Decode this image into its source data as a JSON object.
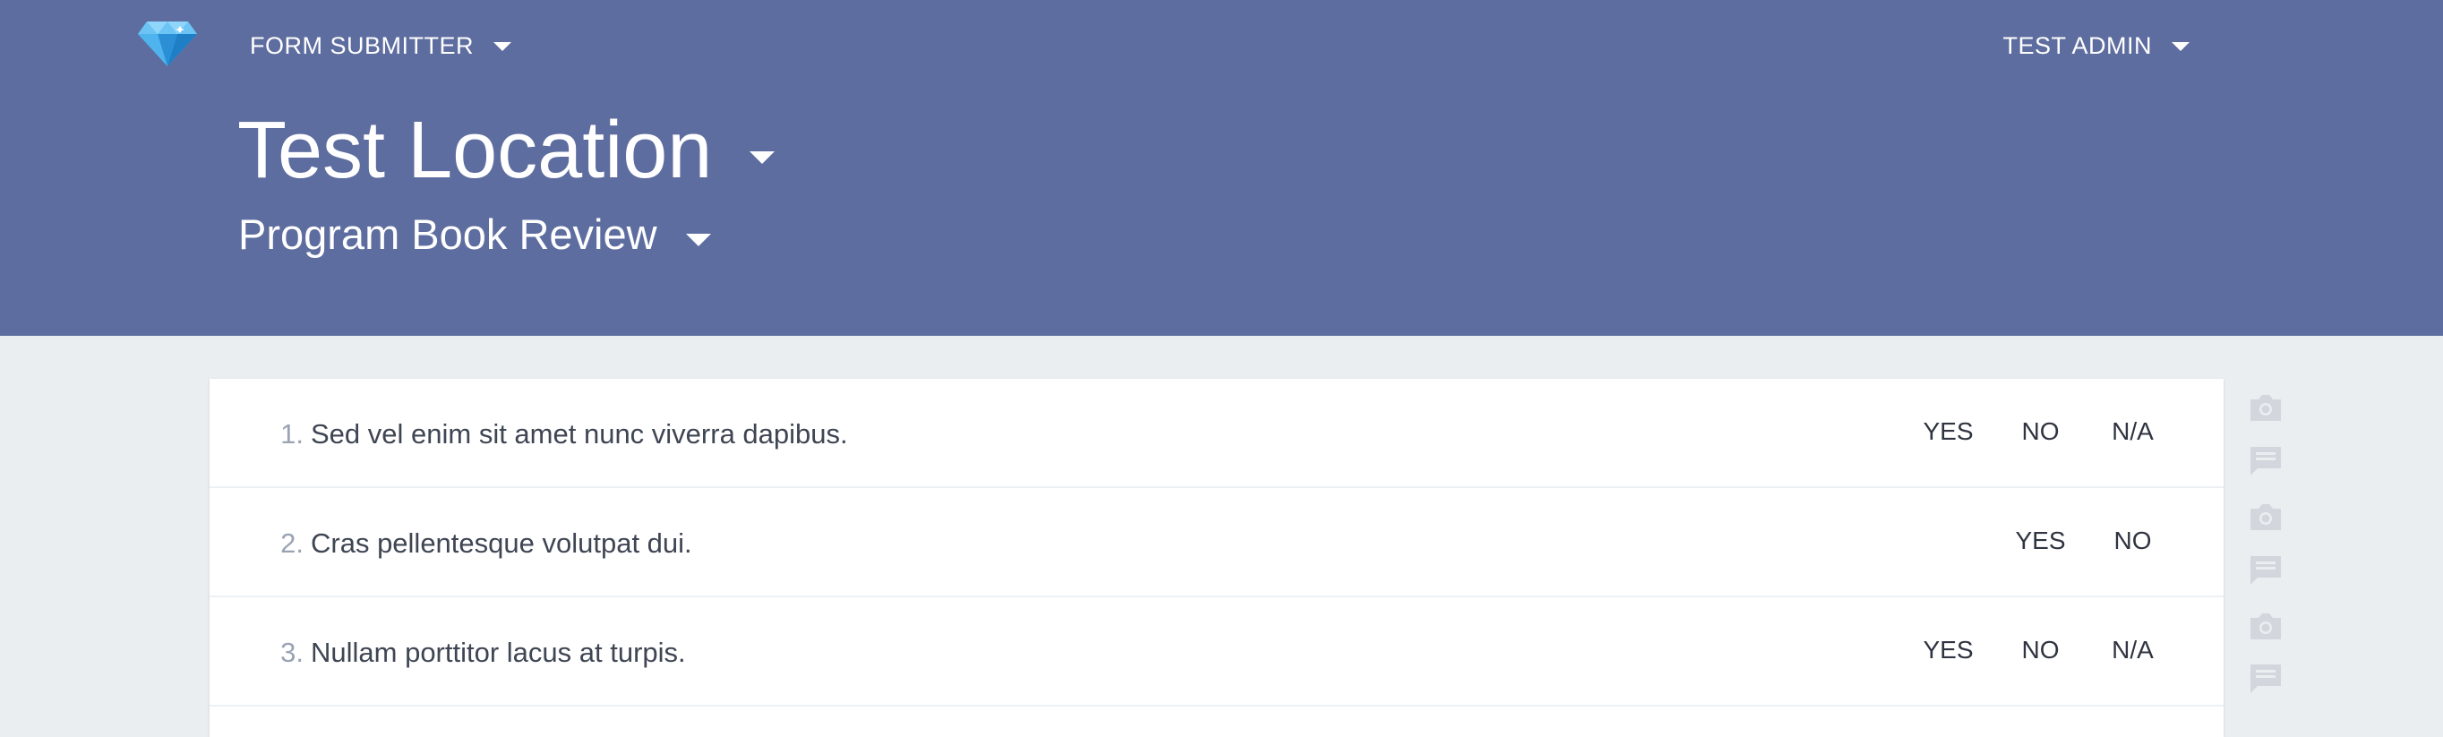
{
  "nav": {
    "app_menu_label": "FORM SUBMITTER",
    "user_menu_label": "TEST ADMIN"
  },
  "location": {
    "title": "Test Location"
  },
  "form": {
    "title": "Program Book Review"
  },
  "questions": [
    {
      "number": "1.",
      "text": "Sed vel enim sit amet nunc viverra dapibus.",
      "options": [
        "YES",
        "NO",
        "N/A"
      ]
    },
    {
      "number": "2.",
      "text": "Cras pellentesque volutpat dui.",
      "options": [
        "YES",
        "NO"
      ]
    },
    {
      "number": "3.",
      "text": "Nullam porttitor lacus at turpis.",
      "options": [
        "YES",
        "NO",
        "N/A"
      ]
    }
  ],
  "icons": {
    "logo": "diamond-logo",
    "photo": "camera-icon",
    "comment": "comment-icon"
  },
  "colors": {
    "header": "#5e6d9f",
    "background": "#ebeef1",
    "icon_muted": "#d3d7dd"
  }
}
